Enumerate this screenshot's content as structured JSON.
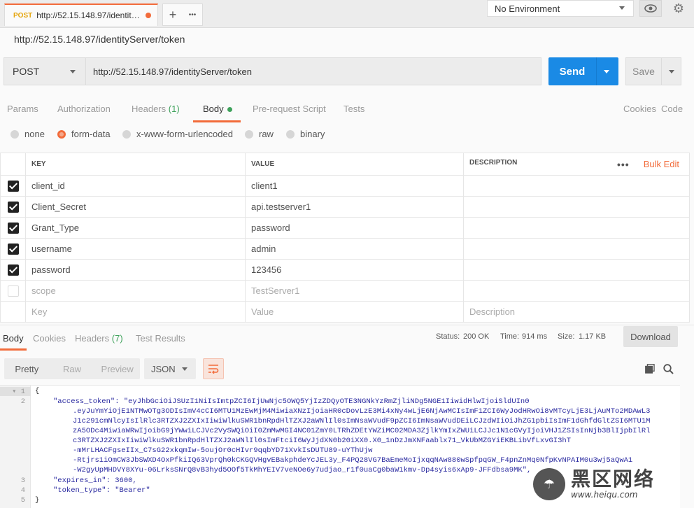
{
  "topbar": {
    "tab_method": "POST",
    "tab_title": "http://52.15.148.97/identityServer/token",
    "add_glyph": "+",
    "more_glyph": "•••",
    "environment": "No Environment",
    "gear_glyph": "⚙"
  },
  "request": {
    "title": "http://52.15.148.97/identityServer/token",
    "method": "POST",
    "url": "http://52.15.148.97/identityServer/token",
    "send_label": "Send",
    "save_label": "Save"
  },
  "req_tabs": {
    "params": "Params",
    "authorization": "Authorization",
    "headers": "Headers",
    "headers_count": "(1)",
    "body": "Body",
    "prerequest": "Pre-request Script",
    "tests": "Tests",
    "cookies": "Cookies",
    "code": "Code"
  },
  "body_types": [
    {
      "label": "none",
      "checked": false
    },
    {
      "label": "form-data",
      "checked": true
    },
    {
      "label": "x-www-form-urlencoded",
      "checked": false
    },
    {
      "label": "raw",
      "checked": false
    },
    {
      "label": "binary",
      "checked": false
    }
  ],
  "kv": {
    "headers": {
      "key": "KEY",
      "value": "VALUE",
      "description": "DESCRIPTION",
      "more": "•••",
      "bulk_edit": "Bulk Edit"
    },
    "rows": [
      {
        "checked": true,
        "key": "client_id",
        "value": "client1"
      },
      {
        "checked": true,
        "key": "Client_Secret",
        "value": "api.testserver1"
      },
      {
        "checked": true,
        "key": "Grant_Type",
        "value": "password"
      },
      {
        "checked": true,
        "key": "username",
        "value": "admin"
      },
      {
        "checked": true,
        "key": "password",
        "value": "123456"
      },
      {
        "checked": false,
        "key": "scope",
        "value": "TestServer1"
      }
    ],
    "placeholder": {
      "key": "Key",
      "value": "Value",
      "description": "Description"
    }
  },
  "response": {
    "tabs": {
      "body": "Body",
      "cookies": "Cookies",
      "headers": "Headers",
      "headers_count": "(7)",
      "tests": "Test Results"
    },
    "status_label": "Status:",
    "status_value": "200 OK",
    "time_label": "Time:",
    "time_value": "914 ms",
    "size_label": "Size:",
    "size_value": "1.17 KB",
    "download": "Download",
    "views": [
      "Pretty",
      "Raw",
      "Preview"
    ],
    "format": "JSON"
  },
  "code": {
    "line_numbers": [
      "1",
      "2",
      "3",
      "4",
      "5"
    ],
    "brace_open": "{",
    "brace_close": "}",
    "key_access": "\"access_token\": ",
    "token_lines": [
      "\"eyJhbGciOiJSUzI1NiIsImtpZCI6IjUwNjc5OWQ5YjIzZDQyOTE3NGNkYzRmZjliNDg5NGE1IiwidHlwIjoiSldUIn0",
      ".eyJuYmYiOjE1NTMwOTg3ODIsImV4cCI6MTU1MzEwMjM4MiwiaXNzIjoiaHR0cDovLzE3Mi4xNy4wLjE6NjAwMCIsImF1ZCI6WyJodHRwOi8vMTcyLjE3LjAuMTo2MDAwL3",
      "J1c291cmNlcyIsIlRlc3RTZXJ2ZXIxIiwiWlkuSWR1bnRpdHlTZXJ2aWNlIl0sImNsaWVudF9pZCI6ImNsaWVudDEiLCJzdWIiOiJhZG1pbiIsImF1dGhfdGltZSI6MTU1M",
      "zA5ODc4MiwiaWRwIjoibG9jYWwiLCJVc2VySWQiOiI0ZmMwMGI4NC01ZmY0LTRhZDEtYWZiMC02MDA3ZjlkYmIxZWUiLCJJc1N1cGVyIjoiVHJ1ZSIsInNjb3BlIjpbIlRl",
      "c3RTZXJ2ZXIxIiwiWlkuSWR1bnRpdHlTZXJ2aWNlIl0sImFtciI6WyJjdXN0b20iXX0.X0_1nDzJmXNFaablx71_VkUbMZGYiEKBLibVfLxvGI3hT",
      "-mMrLHACFgseIIx_C7sG22xkqmIw-5oujOr0cHIvr9qqbYD71XvkIsDUTU89-uYThUjw",
      "-Rtjrs1iOmCW3JbSWXD4OxPfkiIQ63VprQh0kCKGQVHgvEBakphdeYcJEL3y_F4PQ28VG7BaEmeMoIjxqqNAw880wSpfpqGW_F4pnZnMq0NfpKvNPAIM0u3wj5aQwA1",
      "-W2gyUpMHDVY8XYu-06LrksSNrQ8vB3hyd5OOf5TkMhYEIV7veNOe6y7udjao_r1f0uaCg0baW1kmv-Dp4syis6xAp9-JFFdbsa9MK\","
    ],
    "expires_key": "\"expires_in\": ",
    "expires_val": "3600,",
    "type_key": "\"token_type\": ",
    "type_val": "\"Bearer\""
  },
  "watermark": {
    "logo_glyph": "☂",
    "big": "黑区网络",
    "small": "www.heiqu.com"
  }
}
